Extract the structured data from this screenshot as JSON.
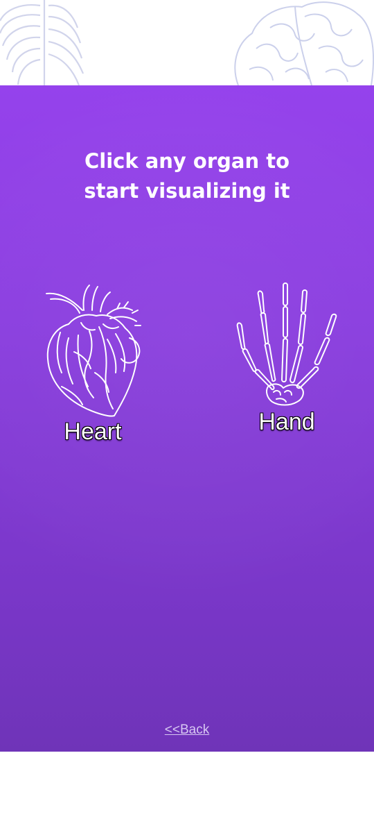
{
  "headline": {
    "line1": "Click any organ to",
    "line2": "start visualizing it"
  },
  "organs": [
    {
      "label": "Heart",
      "icon": "heart-anatomy-icon"
    },
    {
      "label": "Hand",
      "icon": "hand-skeleton-icon"
    }
  ],
  "back_link": {
    "label": "<<Back"
  },
  "colors": {
    "panel_top": "#9542ec",
    "panel_bottom": "#6f34b8",
    "text": "#ffffff",
    "link": "#d7c7f2"
  }
}
